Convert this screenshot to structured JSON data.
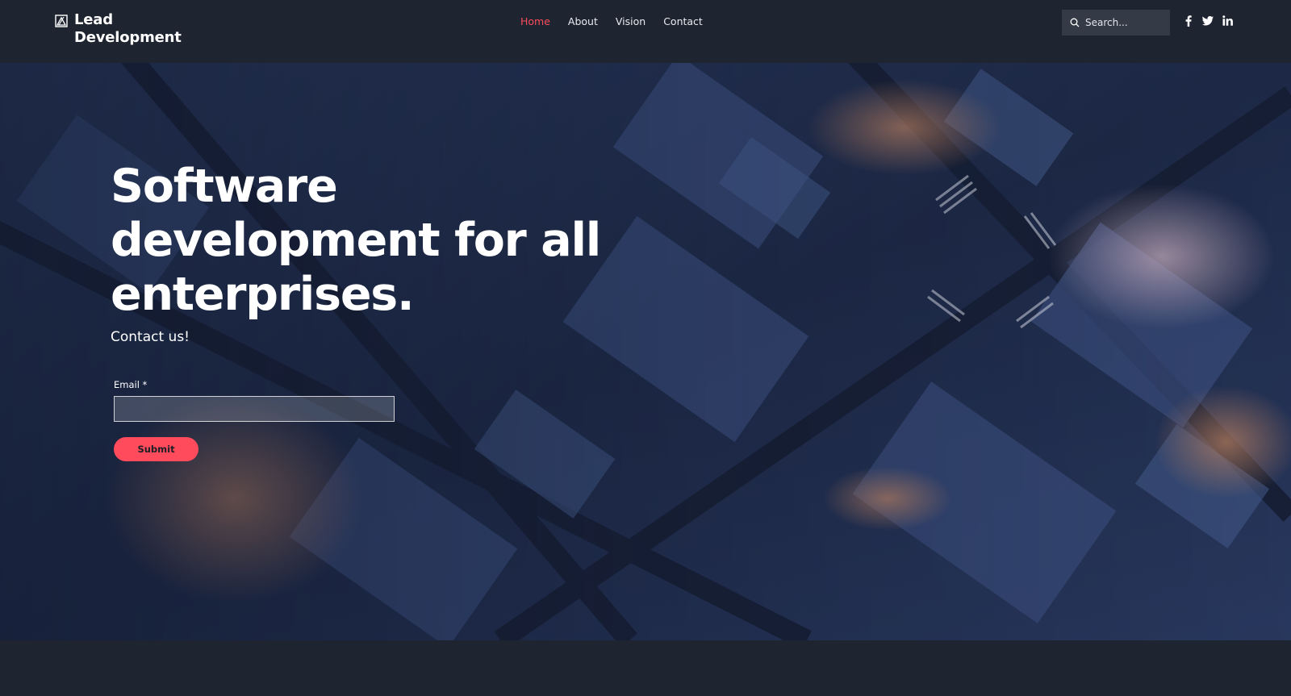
{
  "brand": {
    "line1": "Lead",
    "line2": "Development"
  },
  "nav": {
    "items": [
      {
        "label": "Home",
        "active": true
      },
      {
        "label": "About",
        "active": false
      },
      {
        "label": "Vision",
        "active": false
      },
      {
        "label": "Contact",
        "active": false
      }
    ]
  },
  "search": {
    "placeholder": "Search..."
  },
  "social": {
    "icons": [
      "facebook-icon",
      "twitter-icon",
      "linkedin-icon"
    ]
  },
  "hero": {
    "headline_lines": [
      "Software",
      "development for all",
      "enterprises."
    ],
    "subheading": "Contact us!",
    "form": {
      "email_label": "Email *",
      "email_value": "",
      "submit_label": "Submit"
    }
  },
  "colors": {
    "background": "#1f2530",
    "accent": "#ff4b5c",
    "search_bg": "#343b47"
  }
}
